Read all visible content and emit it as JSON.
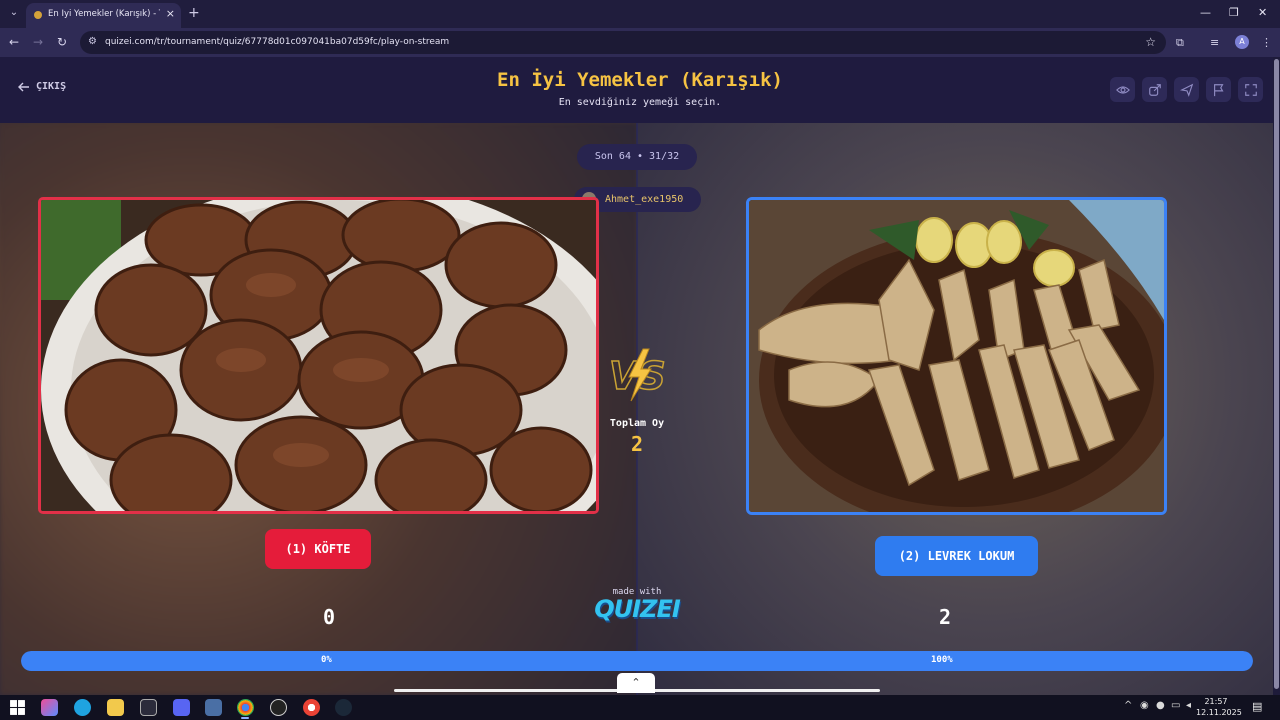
{
  "browser": {
    "tab_title": "En İyi Yemekler (Karışık) - Tier List",
    "url": "quizei.com/tr/tournament/quiz/67778d01c097041ba07d59fc/play-on-stream",
    "profile_initial": "A"
  },
  "header": {
    "exit_label": "ÇIKIŞ",
    "title": "En İyi Yemekler (Karışık)",
    "subtitle": "En sevdiğiniz yemeği seçin."
  },
  "match": {
    "round": "Son 64 • 31/32",
    "voter": "Ahmet_exe1950",
    "total_votes_label": "Toplam Oy",
    "total_votes": "2"
  },
  "left": {
    "label": "(1) KÖFTE",
    "score": "0",
    "percent_label": "0%",
    "share": 0,
    "color": "#e51c3a"
  },
  "right": {
    "label": "(2) LEVREK LOKUM",
    "score": "2",
    "percent_label": "100%",
    "share": 100,
    "color": "#2f7cf0"
  },
  "footer": {
    "made_with": "made with",
    "brand": "QUIZEI"
  },
  "taskbar": {
    "time": "21:57",
    "date": "12.11.2025"
  },
  "icons": [
    "search-icon",
    "close-icon",
    "plus-icon",
    "back-arrow-icon",
    "forward-arrow-icon",
    "reload-icon",
    "site-info-icon",
    "star-icon",
    "extensions-icon",
    "menu-icon",
    "eye-icon",
    "share-icon",
    "send-icon",
    "flag-icon",
    "fullscreen-icon",
    "vs-lightning-icon",
    "chevron-up-icon",
    "windows-start-icon"
  ]
}
